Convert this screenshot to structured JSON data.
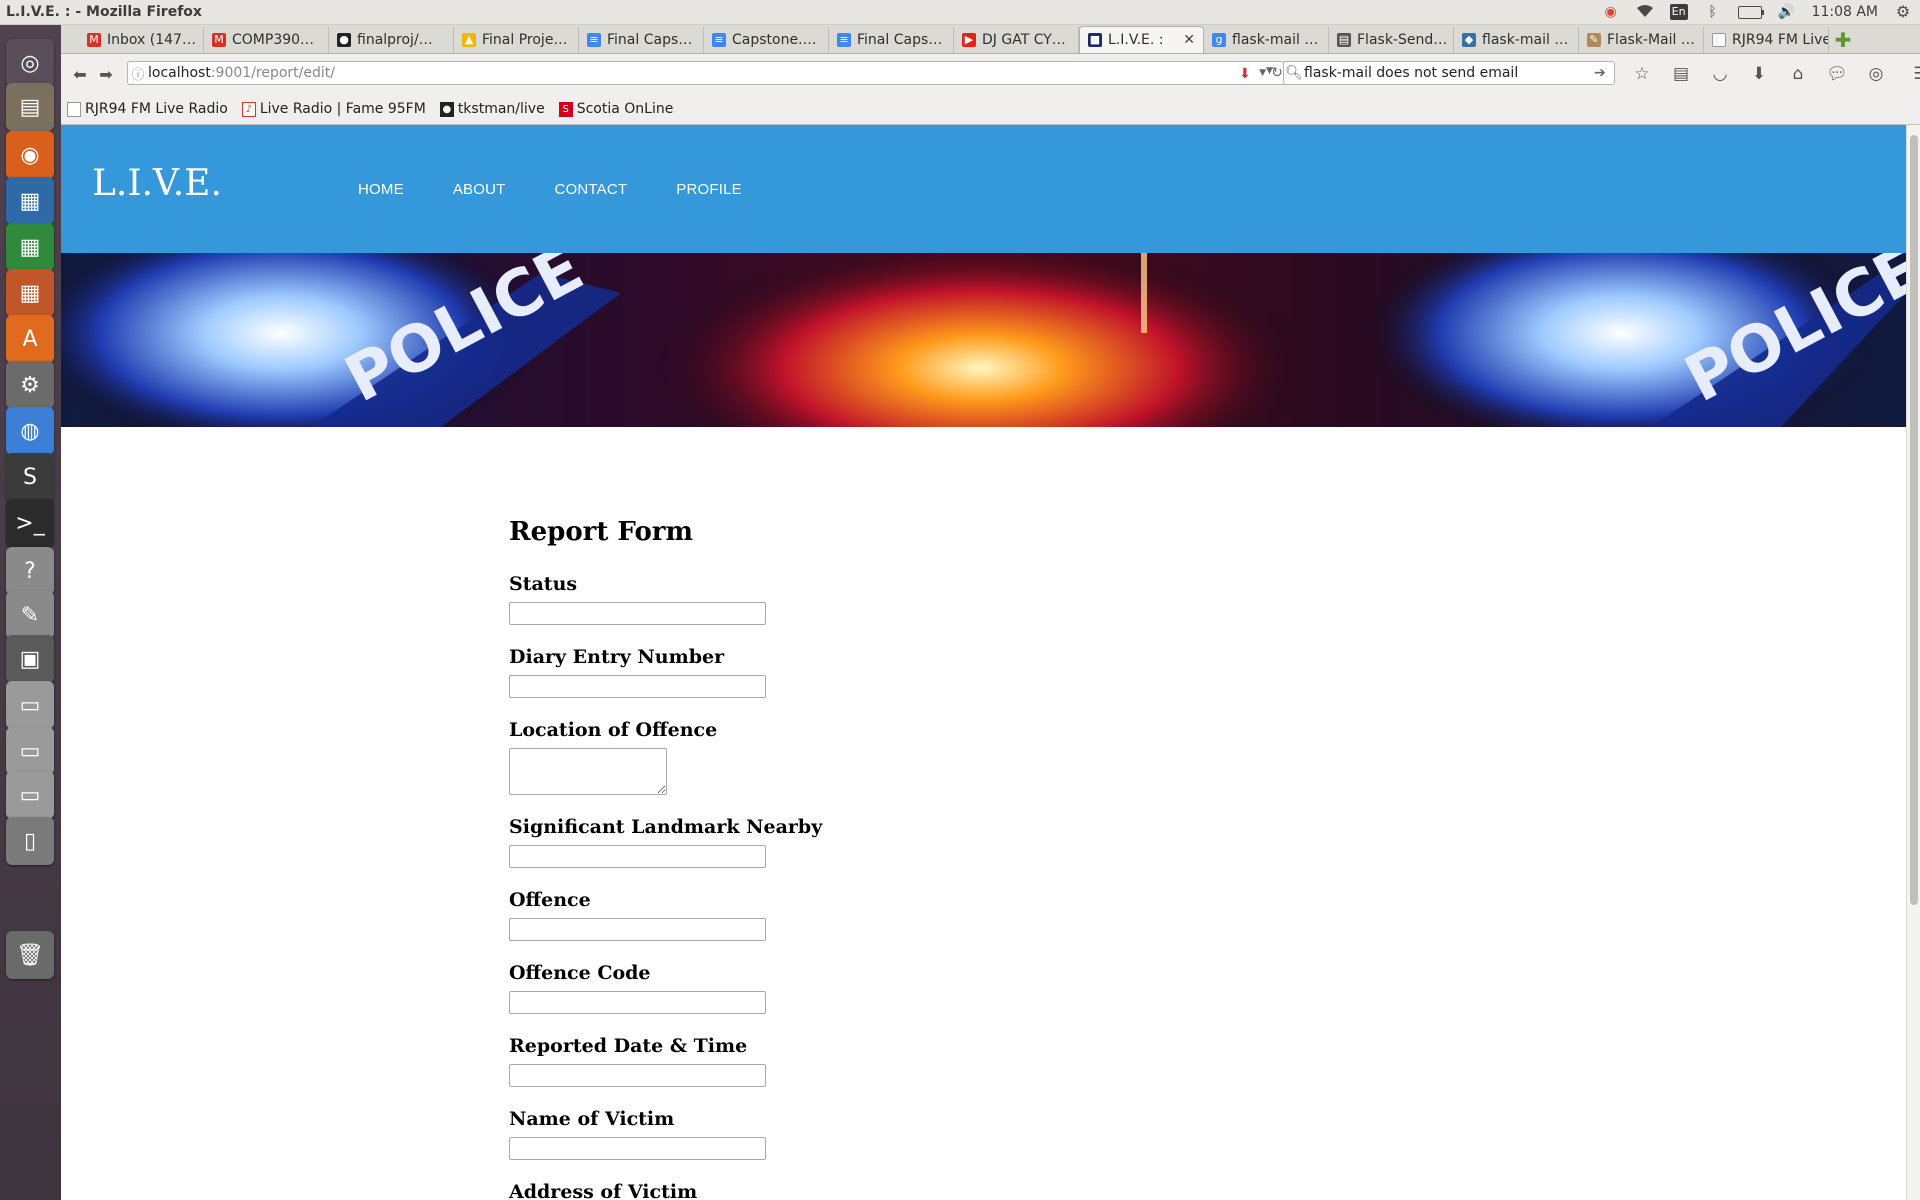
{
  "window": {
    "title": "L.I.V.E. : - Mozilla Firefox"
  },
  "panel": {
    "language": "En",
    "time": "11:08 AM"
  },
  "launcher": {
    "items": [
      {
        "name": "dash-home",
        "color": "#5a4f59",
        "glyph": "◎"
      },
      {
        "name": "files",
        "color": "#7b6f5e",
        "glyph": "▤"
      },
      {
        "name": "firefox",
        "color": "#d9601c",
        "glyph": "◉"
      },
      {
        "name": "writer",
        "color": "#2e6aa8",
        "glyph": "▦"
      },
      {
        "name": "calc",
        "color": "#2f8a3c",
        "glyph": "▦"
      },
      {
        "name": "impress",
        "color": "#c0562a",
        "glyph": "▦"
      },
      {
        "name": "software-center",
        "color": "#e06b1f",
        "glyph": "A"
      },
      {
        "name": "settings",
        "color": "#6b6b6b",
        "glyph": "⚙"
      },
      {
        "name": "chrome",
        "color": "#3c7fd6",
        "glyph": "◍"
      },
      {
        "name": "sublime",
        "color": "#3b3b3b",
        "glyph": "S"
      },
      {
        "name": "terminal",
        "color": "#2b2b2b",
        "glyph": ">_"
      },
      {
        "name": "help",
        "color": "#8a8a8a",
        "glyph": "?"
      },
      {
        "name": "text-editor",
        "color": "#8a8a8a",
        "glyph": "✎"
      },
      {
        "name": "workspaces",
        "color": "#5a5a5a",
        "glyph": "▣"
      },
      {
        "name": "drive-1",
        "color": "#9a9a9a",
        "glyph": "▭"
      },
      {
        "name": "drive-2",
        "color": "#9a9a9a",
        "glyph": "▭"
      },
      {
        "name": "drive-3",
        "color": "#9a9a9a",
        "glyph": "▭"
      },
      {
        "name": "media-player",
        "color": "#7a7a7a",
        "glyph": "▯"
      },
      {
        "name": "trash",
        "color": "#6a6a6a",
        "glyph": "🗑"
      }
    ]
  },
  "tabs": [
    {
      "label": "Inbox (147…",
      "fav_color": "#d93025",
      "fav_glyph": "M",
      "active": false
    },
    {
      "label": "COMP390…",
      "fav_color": "#d93025",
      "fav_glyph": "M",
      "active": false
    },
    {
      "label": "finalproj/…",
      "fav_color": "#222222",
      "fav_glyph": "●",
      "active": false
    },
    {
      "label": "Final Proje…",
      "fav_color": "#f4b400",
      "fav_glyph": "▲",
      "active": false
    },
    {
      "label": "Final Caps…",
      "fav_color": "#4285f4",
      "fav_glyph": "≡",
      "active": false
    },
    {
      "label": "Capstone.…",
      "fav_color": "#4285f4",
      "fav_glyph": "≡",
      "active": false
    },
    {
      "label": "Final Caps…",
      "fav_color": "#4285f4",
      "fav_glyph": "≡",
      "active": false
    },
    {
      "label": "DJ GAT CY…",
      "fav_color": "#e62117",
      "fav_glyph": "▶",
      "active": false
    },
    {
      "label": "L.I.V.E. :",
      "fav_color": "#1a2a6c",
      "fav_glyph": "■",
      "active": true
    },
    {
      "label": "flask-mail …",
      "fav_color": "#4285f4",
      "fav_glyph": "g",
      "active": false
    },
    {
      "label": "Flask-Send…",
      "fav_color": "#555555",
      "fav_glyph": "▤",
      "active": false
    },
    {
      "label": "flask-mail …",
      "fav_color": "#3572a5",
      "fav_glyph": "◆",
      "active": false
    },
    {
      "label": "Flask-Mail …",
      "fav_color": "#b08a5a",
      "fav_glyph": "✎",
      "active": false
    },
    {
      "label": "RJR94 FM Live…",
      "fav_color": "#ffffff",
      "fav_glyph": "",
      "active": false
    }
  ],
  "urlbar": {
    "host": "localhost",
    "path": ":9001/report/edit/"
  },
  "search": {
    "value": "flask-mail does not send email"
  },
  "bookmarks": [
    {
      "label": "RJR94 FM Live Radio",
      "icon": "page-icon"
    },
    {
      "label": "Live Radio | Fame 95FM",
      "icon": "radio-icon"
    },
    {
      "label": "tkstman/live",
      "icon": "github-icon"
    },
    {
      "label": "Scotia OnLine",
      "icon": "scotia-icon"
    }
  ],
  "site": {
    "brand": "L.I.V.E.",
    "nav": [
      "HOME",
      "ABOUT",
      "CONTACT",
      "PROFILE"
    ],
    "header_color": "#3498db",
    "banner_text": "POLICE"
  },
  "form": {
    "title": "Report Form",
    "fields": [
      {
        "label": "Status",
        "type": "input",
        "value": ""
      },
      {
        "label": "Diary Entry Number",
        "type": "input",
        "value": ""
      },
      {
        "label": "Location of Offence",
        "type": "textarea",
        "value": ""
      },
      {
        "label": "Significant Landmark Nearby",
        "type": "input",
        "value": ""
      },
      {
        "label": "Offence",
        "type": "input",
        "value": ""
      },
      {
        "label": "Offence Code",
        "type": "input",
        "value": ""
      },
      {
        "label": "Reported Date & Time",
        "type": "input",
        "value": ""
      },
      {
        "label": "Name of Victim",
        "type": "input",
        "value": ""
      },
      {
        "label": "Address of Victim",
        "type": "input",
        "value": ""
      }
    ]
  }
}
